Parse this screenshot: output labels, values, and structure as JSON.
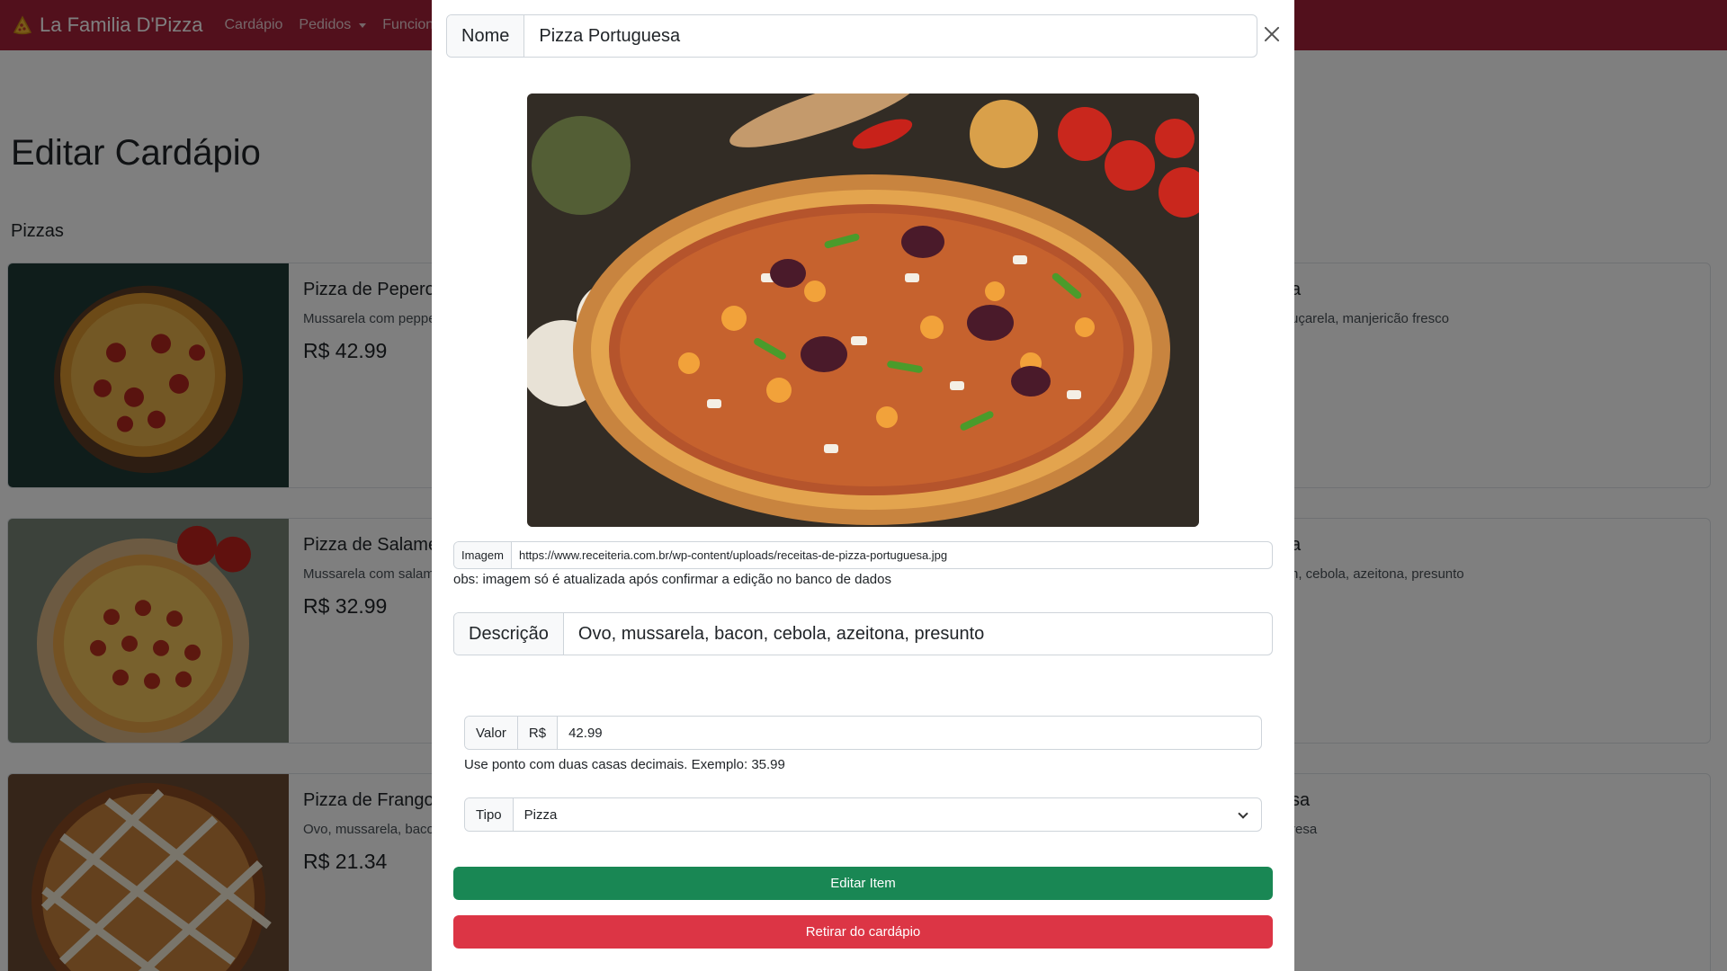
{
  "navbar": {
    "brand": "La Familia D'Pizza",
    "links": [
      {
        "label": "Cardápio"
      },
      {
        "label": "Pedidos"
      },
      {
        "label": "Funcionários"
      }
    ]
  },
  "page": {
    "title": "Editar Cardápio",
    "section_title": "Pizzas"
  },
  "cards_left": [
    {
      "title": "Pizza de Peperoni",
      "description": "Mussarela com pepperoni",
      "price": "R$ 42.99"
    },
    {
      "title": "Pizza de Salame",
      "description": "Mussarela com salame",
      "price": "R$ 32.99"
    },
    {
      "title": "Pizza de Frango",
      "description": "Ovo, mussarela, bacon",
      "price": "R$ 21.34"
    }
  ],
  "cards_right": [
    {
      "title": "a",
      "description": "uçarela, manjericão fresco"
    },
    {
      "title": "a",
      "description": "n, cebola, azeitona, presunto"
    },
    {
      "title": "sa",
      "description": "resa"
    }
  ],
  "modal": {
    "nome_label": "Nome",
    "nome_value": "Pizza Portuguesa",
    "imagem_label": "Imagem",
    "imagem_value": "https://www.receiteria.com.br/wp-content/uploads/receitas-de-pizza-portuguesa.jpg",
    "imagem_note": "obs: imagem só é atualizada após confirmar a edição no banco de dados",
    "descricao_label": "Descrição",
    "descricao_value": "Ovo, mussarela, bacon, cebola, azeitona, presunto",
    "valor_label": "Valor",
    "currency": "R$",
    "valor_value": "42.99",
    "valor_hint": "Use ponto com duas casas decimais. Exemplo: 35.99",
    "tipo_label": "Tipo",
    "tipo_value": "Pizza",
    "edit_button": "Editar Item",
    "remove_button": "Retirar do cardápio"
  },
  "colors": {
    "navbar": "#a52038",
    "success": "#198754",
    "danger": "#dc3545"
  },
  "icons": [
    "pizza-logo-icon",
    "caret-down-icon",
    "close-icon",
    "chevron-down-icon"
  ]
}
